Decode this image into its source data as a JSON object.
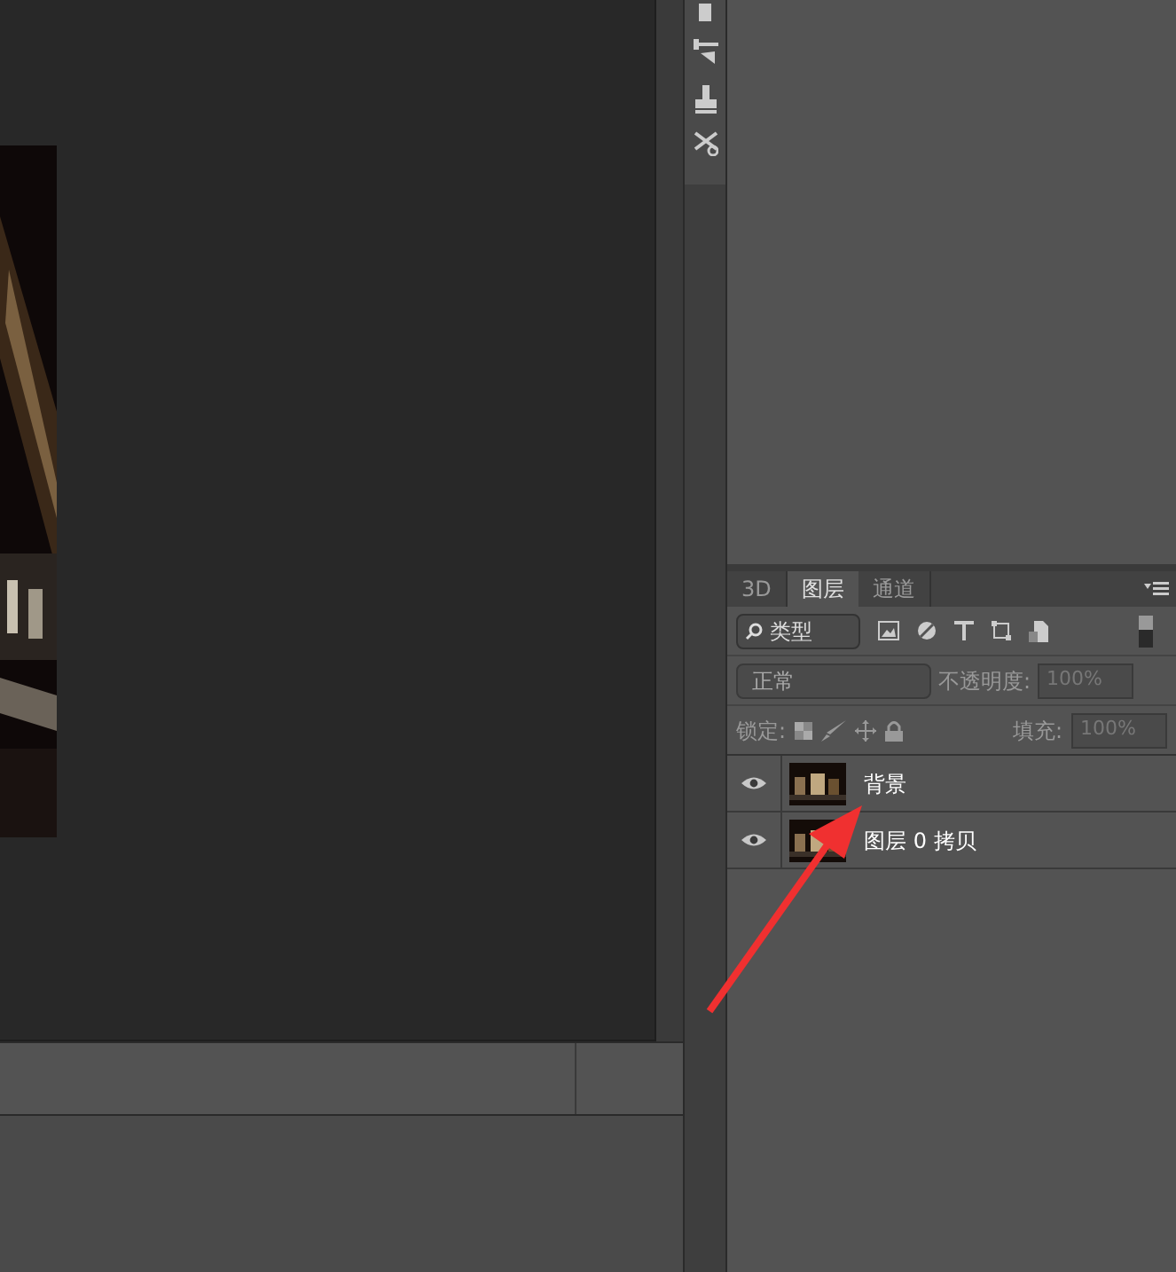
{
  "layers_panel": {
    "tabs": [
      {
        "label": "3D",
        "selected": false
      },
      {
        "label": "图层",
        "selected": true
      },
      {
        "label": "通道",
        "selected": false
      }
    ],
    "filter": {
      "label": "类型"
    },
    "blend_mode": "正常",
    "opacity_label": "不透明度:",
    "opacity": "100%",
    "lock_label": "锁定:",
    "fill_label": "填充:",
    "fill": "100%",
    "layers": [
      {
        "name": "背景",
        "visible": true
      },
      {
        "name": "图层 0 拷贝",
        "visible": true
      }
    ]
  }
}
